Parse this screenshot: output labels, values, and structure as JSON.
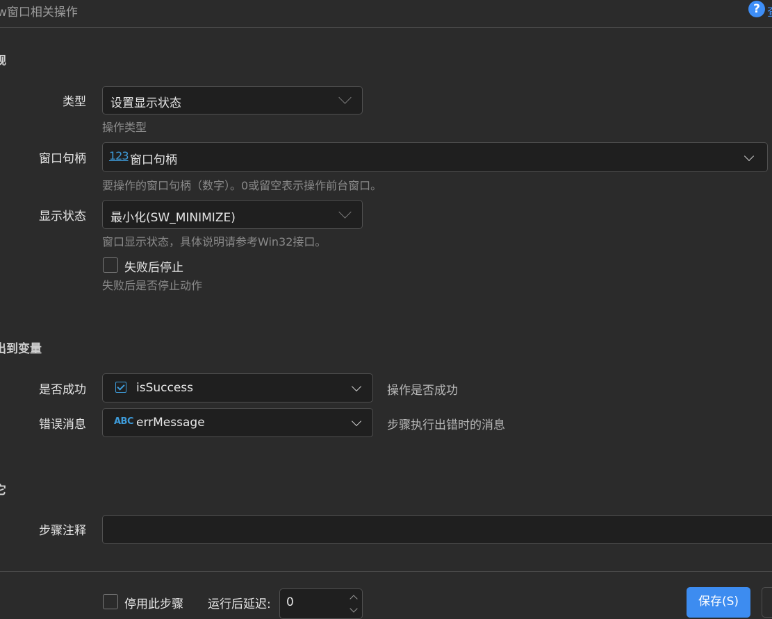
{
  "header": {
    "title": "w窗口相关操作",
    "help_link": "查"
  },
  "sections": {
    "general": "规",
    "output": "出到变量",
    "other": "它"
  },
  "fields": {
    "type": {
      "label": "类型",
      "value": "设置显示状态",
      "hint": "操作类型"
    },
    "handle": {
      "label": "窗口句柄",
      "badge": "123",
      "value": "窗口句柄",
      "hint": "要操作的窗口句柄（数字）。0或留空表示操作前台窗口。"
    },
    "state": {
      "label": "显示状态",
      "value": "最小化(SW_MINIMIZE)",
      "hint": "窗口显示状态，具体说明请参考Win32接口。"
    },
    "stop_on_fail": {
      "label": "失败后停止",
      "hint": "失败后是否停止动作",
      "checked": false
    },
    "success": {
      "label": "是否成功",
      "value": "isSuccess",
      "desc": "操作是否成功"
    },
    "error": {
      "label": "错误消息",
      "badge": "ABC",
      "value": "errMessage",
      "desc": "步骤执行出错时的消息"
    },
    "note": {
      "label": "步骤注释",
      "value": ""
    }
  },
  "footer": {
    "disable_label": "停用此步骤",
    "delay_label": "运行后延迟:",
    "delay_value": "0",
    "save_label": "保存(S)"
  },
  "icons": [
    "help-icon",
    "chevron-down-icon",
    "number-type-icon",
    "boolean-checkbox-icon",
    "text-type-icon"
  ],
  "colors": {
    "background": "#2b2b2b",
    "field_bg": "#1f1f1f",
    "accent": "#3d8cf0",
    "type_icon": "#3e9bd9"
  }
}
